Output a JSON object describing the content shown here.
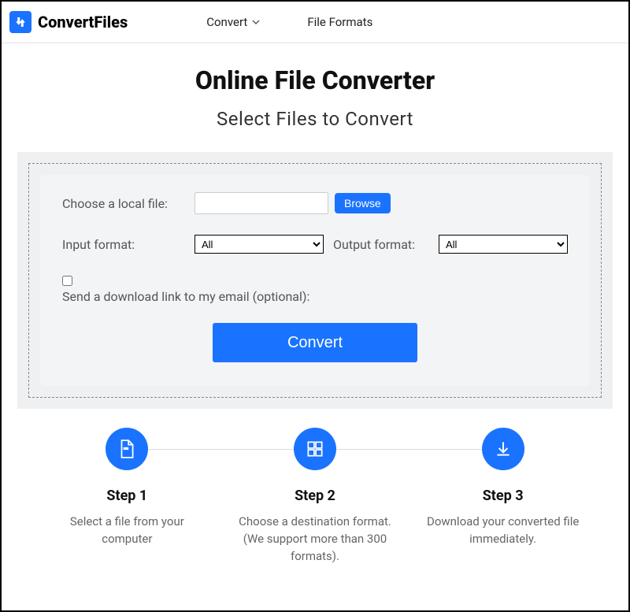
{
  "brand": {
    "name": "ConvertFiles"
  },
  "nav": {
    "convert": "Convert",
    "formats": "File Formats"
  },
  "title": "Online File Converter",
  "subtitle": "Select Files to Convert",
  "form": {
    "choose_label": "Choose a local file:",
    "browse": "Browse",
    "input_format_label": "Input format:",
    "output_format_label": "Output format:",
    "input_format_value": "All",
    "output_format_value": "All",
    "email_label": "Send a download link to my email (optional):",
    "convert": "Convert"
  },
  "steps": [
    {
      "title": "Step 1",
      "desc": "Select a file from your computer"
    },
    {
      "title": "Step 2",
      "desc": "Choose a destination format. (We support more than 300 formats)."
    },
    {
      "title": "Step 3",
      "desc": "Download your converted file immediately."
    }
  ]
}
